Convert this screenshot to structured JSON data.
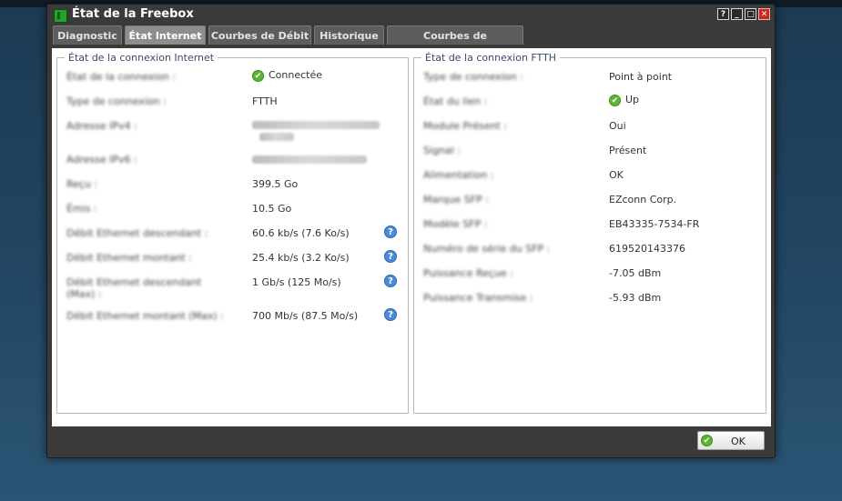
{
  "window": {
    "title": "État de la Freebox",
    "controls": {
      "help": "?",
      "minimize": "_",
      "maximize": "□",
      "close": "✕"
    }
  },
  "tabs": [
    {
      "label": "Diagnostic",
      "active": false
    },
    {
      "label": "État Internet",
      "active": true
    },
    {
      "label": "Courbes de Débit",
      "active": false
    },
    {
      "label": "Historique",
      "active": false
    },
    {
      "label": "Courbes de température",
      "active": false
    }
  ],
  "internet": {
    "legend": "État de la connexion Internet",
    "rows": [
      {
        "label": "État de la connexion :",
        "value": "Connectée",
        "status": "ok"
      },
      {
        "label": "Type de connexion :",
        "value": "FTTH"
      },
      {
        "label": "Adresse IPv4 :",
        "value": ""
      },
      {
        "label": "Adresse IPv6 :",
        "value": ""
      },
      {
        "label": "Reçu :",
        "value": "399.5 Go"
      },
      {
        "label": "Émis :",
        "value": "10.5 Go"
      },
      {
        "label": "Débit Ethernet descendant :",
        "value": "60.6 kb/s (7.6 Ko/s)",
        "info": true
      },
      {
        "label": "Débit Ethernet montant :",
        "value": "25.4 kb/s (3.2 Ko/s)",
        "info": true
      },
      {
        "label": "Débit Ethernet descendant (Max) :",
        "value": "1 Gb/s (125 Mo/s)",
        "info": true
      },
      {
        "label": "Débit Ethernet montant (Max) :",
        "value": "700 Mb/s (87.5 Mo/s)",
        "info": true
      }
    ]
  },
  "ftth": {
    "legend": "État de la connexion FTTH",
    "rows": [
      {
        "label": "Type de connexion :",
        "value": "Point à point"
      },
      {
        "label": "État du lien :",
        "value": "Up",
        "status": "ok"
      },
      {
        "label": "Module Présent :",
        "value": "Oui"
      },
      {
        "label": "Signal :",
        "value": "Présent"
      },
      {
        "label": "Alimentation :",
        "value": "OK"
      },
      {
        "label": "Marque SFP :",
        "value": "EZconn Corp."
      },
      {
        "label": "Modèle SFP :",
        "value": "EB43335-7534-FR"
      },
      {
        "label": "Numéro de série du SFP :",
        "value": "619520143376"
      },
      {
        "label": "Puissance Reçue :",
        "value": "-7.05 dBm"
      },
      {
        "label": "Puissance Transmise :",
        "value": "-5.93 dBm"
      }
    ]
  },
  "footer": {
    "ok_label": "OK"
  },
  "colors": {
    "status_ok": "#5fb531",
    "info": "#4a8ad6",
    "close": "#c8281e",
    "brand_icon": "#22a22a"
  },
  "icons": {
    "status": "check-circle-icon",
    "info": "question-circle-icon",
    "app": "freebox-icon"
  }
}
